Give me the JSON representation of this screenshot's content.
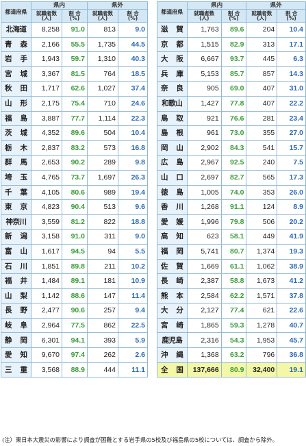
{
  "header": {
    "pref_label": "都道府県",
    "in_pref": "県内",
    "out_pref": "県外",
    "employed": "就職者数\n(人)",
    "ratio": "割 合\n(%)"
  },
  "left_rows": [
    {
      "pref": "北海道",
      "in_n": "8,258",
      "in_r": "91.0",
      "out_n": "813",
      "out_r": "9.0"
    },
    {
      "pref": "青森",
      "in_n": "2,166",
      "in_r": "55.5",
      "out_n": "1,735",
      "out_r": "44.5"
    },
    {
      "pref": "岩手",
      "in_n": "1,943",
      "in_r": "59.7",
      "out_n": "1,310",
      "out_r": "40.3"
    },
    {
      "pref": "宮城",
      "in_n": "3,367",
      "in_r": "81.5",
      "out_n": "764",
      "out_r": "18.5"
    },
    {
      "pref": "秋田",
      "in_n": "1,717",
      "in_r": "62.6",
      "out_n": "1,027",
      "out_r": "37.4"
    },
    {
      "pref": "山形",
      "in_n": "2,175",
      "in_r": "75.4",
      "out_n": "710",
      "out_r": "24.6"
    },
    {
      "pref": "福島",
      "in_n": "3,887",
      "in_r": "77.7",
      "out_n": "1,114",
      "out_r": "22.3"
    },
    {
      "pref": "茨城",
      "in_n": "4,352",
      "in_r": "89.6",
      "out_n": "504",
      "out_r": "10.4"
    },
    {
      "pref": "栃木",
      "in_n": "2,837",
      "in_r": "83.2",
      "out_n": "573",
      "out_r": "16.8"
    },
    {
      "pref": "群馬",
      "in_n": "2,653",
      "in_r": "90.2",
      "out_n": "289",
      "out_r": "9.8"
    },
    {
      "pref": "埼玉",
      "in_n": "4,765",
      "in_r": "73.7",
      "out_n": "1,697",
      "out_r": "26.3"
    },
    {
      "pref": "千葉",
      "in_n": "4,105",
      "in_r": "80.6",
      "out_n": "989",
      "out_r": "19.4"
    },
    {
      "pref": "東京",
      "in_n": "4,823",
      "in_r": "90.4",
      "out_n": "513",
      "out_r": "9.6"
    },
    {
      "pref": "神奈川",
      "in_n": "3,559",
      "in_r": "81.2",
      "out_n": "822",
      "out_r": "18.8"
    },
    {
      "pref": "新潟",
      "in_n": "3,158",
      "in_r": "91.0",
      "out_n": "311",
      "out_r": "9.0"
    },
    {
      "pref": "富山",
      "in_n": "1,617",
      "in_r": "94.5",
      "out_n": "94",
      "out_r": "5.5"
    },
    {
      "pref": "石川",
      "in_n": "1,851",
      "in_r": "89.8",
      "out_n": "211",
      "out_r": "10.2"
    },
    {
      "pref": "福井",
      "in_n": "1,484",
      "in_r": "89.1",
      "out_n": "181",
      "out_r": "10.9"
    },
    {
      "pref": "山梨",
      "in_n": "1,142",
      "in_r": "88.6",
      "out_n": "147",
      "out_r": "11.4"
    },
    {
      "pref": "長野",
      "in_n": "2,477",
      "in_r": "90.6",
      "out_n": "257",
      "out_r": "9.4"
    },
    {
      "pref": "岐阜",
      "in_n": "2,964",
      "in_r": "77.5",
      "out_n": "862",
      "out_r": "22.5"
    },
    {
      "pref": "静岡",
      "in_n": "6,301",
      "in_r": "94.1",
      "out_n": "393",
      "out_r": "5.9"
    },
    {
      "pref": "愛知",
      "in_n": "9,670",
      "in_r": "97.4",
      "out_n": "262",
      "out_r": "2.6"
    },
    {
      "pref": "三重",
      "in_n": "3,568",
      "in_r": "88.9",
      "out_n": "444",
      "out_r": "11.1"
    }
  ],
  "right_rows": [
    {
      "pref": "滋賀",
      "in_n": "1,763",
      "in_r": "89.6",
      "out_n": "204",
      "out_r": "10.4"
    },
    {
      "pref": "京都",
      "in_n": "1,515",
      "in_r": "82.9",
      "out_n": "313",
      "out_r": "17.1"
    },
    {
      "pref": "大阪",
      "in_n": "6,667",
      "in_r": "93.7",
      "out_n": "445",
      "out_r": "6.3"
    },
    {
      "pref": "兵庫",
      "in_n": "5,153",
      "in_r": "85.7",
      "out_n": "857",
      "out_r": "14.3"
    },
    {
      "pref": "奈良",
      "in_n": "905",
      "in_r": "69.0",
      "out_n": "407",
      "out_r": "31.0"
    },
    {
      "pref": "和歌山",
      "in_n": "1,427",
      "in_r": "77.8",
      "out_n": "407",
      "out_r": "22.2"
    },
    {
      "pref": "鳥取",
      "in_n": "921",
      "in_r": "76.6",
      "out_n": "281",
      "out_r": "23.4"
    },
    {
      "pref": "島根",
      "in_n": "961",
      "in_r": "73.0",
      "out_n": "355",
      "out_r": "27.0"
    },
    {
      "pref": "岡山",
      "in_n": "2,902",
      "in_r": "84.3",
      "out_n": "541",
      "out_r": "15.7"
    },
    {
      "pref": "広島",
      "in_n": "2,967",
      "in_r": "92.5",
      "out_n": "240",
      "out_r": "7.5"
    },
    {
      "pref": "山口",
      "in_n": "2,697",
      "in_r": "82.7",
      "out_n": "565",
      "out_r": "17.3"
    },
    {
      "pref": "徳島",
      "in_n": "1,005",
      "in_r": "74.0",
      "out_n": "353",
      "out_r": "26.0"
    },
    {
      "pref": "香川",
      "in_n": "1,268",
      "in_r": "91.1",
      "out_n": "124",
      "out_r": "8.9"
    },
    {
      "pref": "愛媛",
      "in_n": "1,996",
      "in_r": "79.8",
      "out_n": "506",
      "out_r": "20.2"
    },
    {
      "pref": "高知",
      "in_n": "623",
      "in_r": "58.1",
      "out_n": "449",
      "out_r": "41.9"
    },
    {
      "pref": "福岡",
      "in_n": "5,741",
      "in_r": "80.7",
      "out_n": "1,374",
      "out_r": "19.3"
    },
    {
      "pref": "佐賀",
      "in_n": "1,669",
      "in_r": "61.1",
      "out_n": "1,062",
      "out_r": "38.9"
    },
    {
      "pref": "長崎",
      "in_n": "2,387",
      "in_r": "58.8",
      "out_n": "1,673",
      "out_r": "41.2"
    },
    {
      "pref": "熊本",
      "in_n": "2,584",
      "in_r": "62.2",
      "out_n": "1,571",
      "out_r": "37.8"
    },
    {
      "pref": "大分",
      "in_n": "2,127",
      "in_r": "77.4",
      "out_n": "621",
      "out_r": "22.6"
    },
    {
      "pref": "宮崎",
      "in_n": "1,865",
      "in_r": "59.3",
      "out_n": "1,278",
      "out_r": "40.7"
    },
    {
      "pref": "鹿児島",
      "in_n": "2,316",
      "in_r": "54.3",
      "out_n": "1,953",
      "out_r": "45.7"
    },
    {
      "pref": "沖縄",
      "in_n": "1,368",
      "in_r": "63.2",
      "out_n": "796",
      "out_r": "36.8"
    },
    {
      "pref": "全国",
      "in_n": "137,666",
      "in_r": "80.9",
      "out_n": "32,400",
      "out_r": "19.1",
      "total": true
    }
  ],
  "note": "(注）東日本大震災の影響により調査が困難とする岩手県の5校及び福島県の5校については、調査から除外。"
}
